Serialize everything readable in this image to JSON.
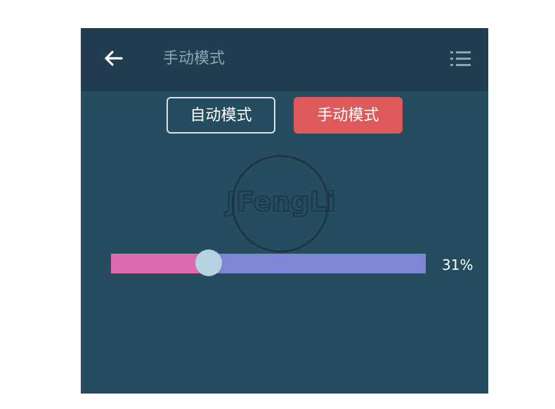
{
  "header": {
    "title": "手动模式",
    "back_icon": "arrow-left-icon",
    "menu_icon": "list-menu-icon"
  },
  "modes": {
    "auto_label": "自动模式",
    "manual_label": "手动模式",
    "selected": "manual"
  },
  "slider": {
    "value": 31,
    "value_text": "31%"
  },
  "watermark": {
    "text": "JFengLi"
  },
  "colors": {
    "background": "#254c5f",
    "header": "#223d50",
    "active_button": "#dc5a5a",
    "slider_fill": "#dc6aae",
    "slider_track": "#7f86d6",
    "thumb": "#b7d3e2"
  }
}
